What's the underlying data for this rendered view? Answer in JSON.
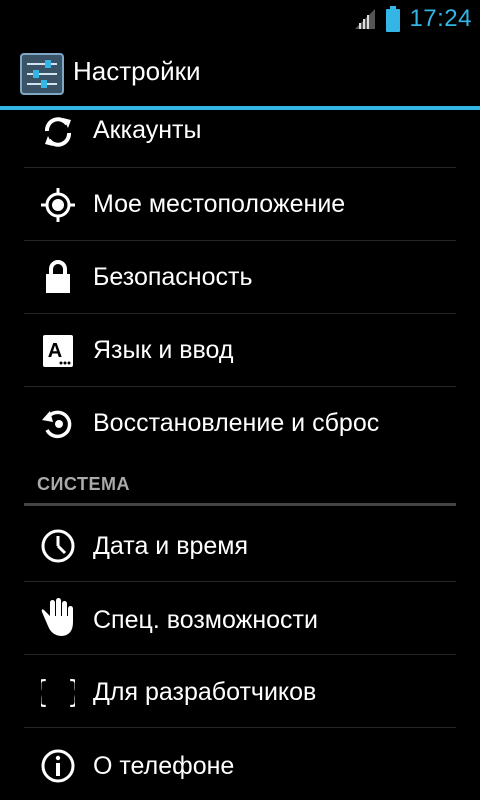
{
  "status_bar": {
    "time": "17:24",
    "accent_color": "#33b5e5"
  },
  "action_bar": {
    "title": "Настройки",
    "icon": "settings-sliders-icon"
  },
  "settings_items": [
    {
      "label": "Аккаунты",
      "icon": "sync-icon"
    },
    {
      "label": "Мое местоположение",
      "icon": "location-target-icon"
    },
    {
      "label": "Безопасность",
      "icon": "lock-icon"
    },
    {
      "label": "Язык и ввод",
      "icon": "keyboard-language-icon"
    },
    {
      "label": "Восстановление и сброс",
      "icon": "restore-icon"
    }
  ],
  "system_section": {
    "header": "СИСТЕМА",
    "items": [
      {
        "label": "Дата и время",
        "icon": "clock-icon"
      },
      {
        "label": "Спец. возможности",
        "icon": "hand-icon"
      },
      {
        "label": "Для разработчиков",
        "icon": "braces-icon"
      },
      {
        "label": "О телефоне",
        "icon": "info-icon"
      }
    ]
  }
}
